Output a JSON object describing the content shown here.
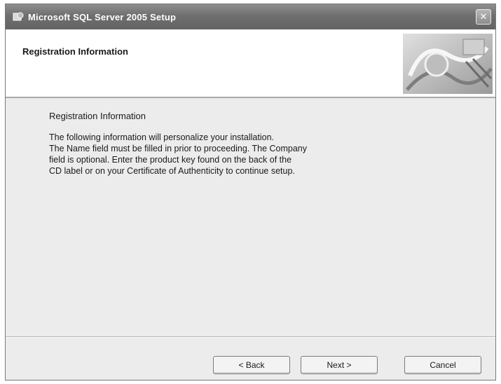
{
  "window": {
    "title": "Microsoft SQL Server 2005 Setup",
    "icon": "installer-icon",
    "close_label": "✕"
  },
  "header": {
    "title": "Registration Information",
    "graphic": "setup-banner-graphic"
  },
  "content": {
    "section_title": "Registration Information",
    "lines": [
      "The following information will personalize your installation.",
      "The Name field must be filled in prior to proceeding. The Company",
      "field is optional. Enter the product key found on the back of the",
      "CD label or on your Certificate of Authenticity to continue setup."
    ]
  },
  "buttons": {
    "back": "< Back",
    "next": "Next >",
    "cancel": "Cancel"
  },
  "colors": {
    "titlebar": "#6f6f6f",
    "dialog_bg": "#ececec",
    "header_bg": "#ffffff"
  }
}
